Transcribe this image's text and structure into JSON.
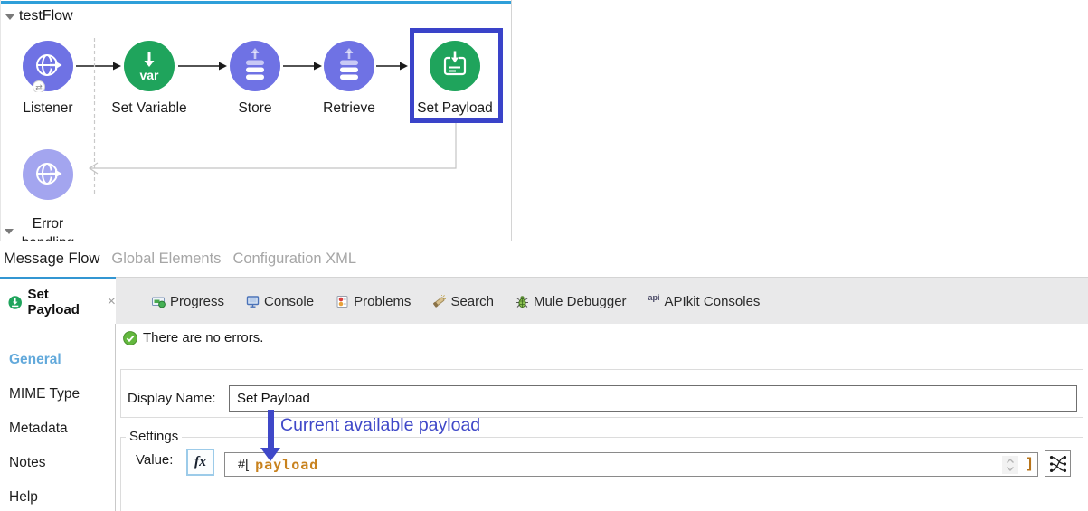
{
  "colors": {
    "canvas_top_line": "#2f9fd9",
    "tab_accent_line": "#3296d2",
    "node_purple": "#6f72e4",
    "node_purple_faded": "#a3a5ef",
    "node_green": "#1fa45c",
    "selection_blue": "#3a43c9",
    "annotation_indigo": "#3f48c8",
    "expression_orange": "#c8821e",
    "sidebar_active_blue": "#62a9db"
  },
  "canvas": {
    "flow_title": "testFlow",
    "nodes": [
      {
        "label": "Listener"
      },
      {
        "label": "Set Variable",
        "badge": "var"
      },
      {
        "label": "Store"
      },
      {
        "label": "Retrieve"
      },
      {
        "label": "Set Payload"
      }
    ],
    "error_node": {
      "label_line1": "Error",
      "label_line2": "handling"
    }
  },
  "editor_tabs": {
    "items": [
      {
        "label": "Message Flow"
      },
      {
        "label": "Global Elements"
      },
      {
        "label": "Configuration XML"
      }
    ]
  },
  "panel": {
    "active_tab": {
      "label": "Set Payload",
      "close_label": "×"
    },
    "tabs": [
      {
        "label": "Progress"
      },
      {
        "label": "Console"
      },
      {
        "label": "Problems"
      },
      {
        "label": "Search"
      },
      {
        "label": "Mule Debugger"
      },
      {
        "label": "APIkit Consoles",
        "icon_text": "api"
      }
    ]
  },
  "sidebar": {
    "items": [
      {
        "label": "General"
      },
      {
        "label": "MIME Type"
      },
      {
        "label": "Metadata"
      },
      {
        "label": "Notes"
      },
      {
        "label": "Help"
      }
    ]
  },
  "properties": {
    "status_text": "There are no errors.",
    "display_name_label": "Display Name:",
    "display_name_value": "Set Payload",
    "settings_label": "Settings",
    "value_label": "Value:",
    "fx_button_label": "fx",
    "expression_prefix": "#[",
    "expression_value": "payload",
    "expression_suffix": "]",
    "annotation_text": "Current available payload"
  }
}
